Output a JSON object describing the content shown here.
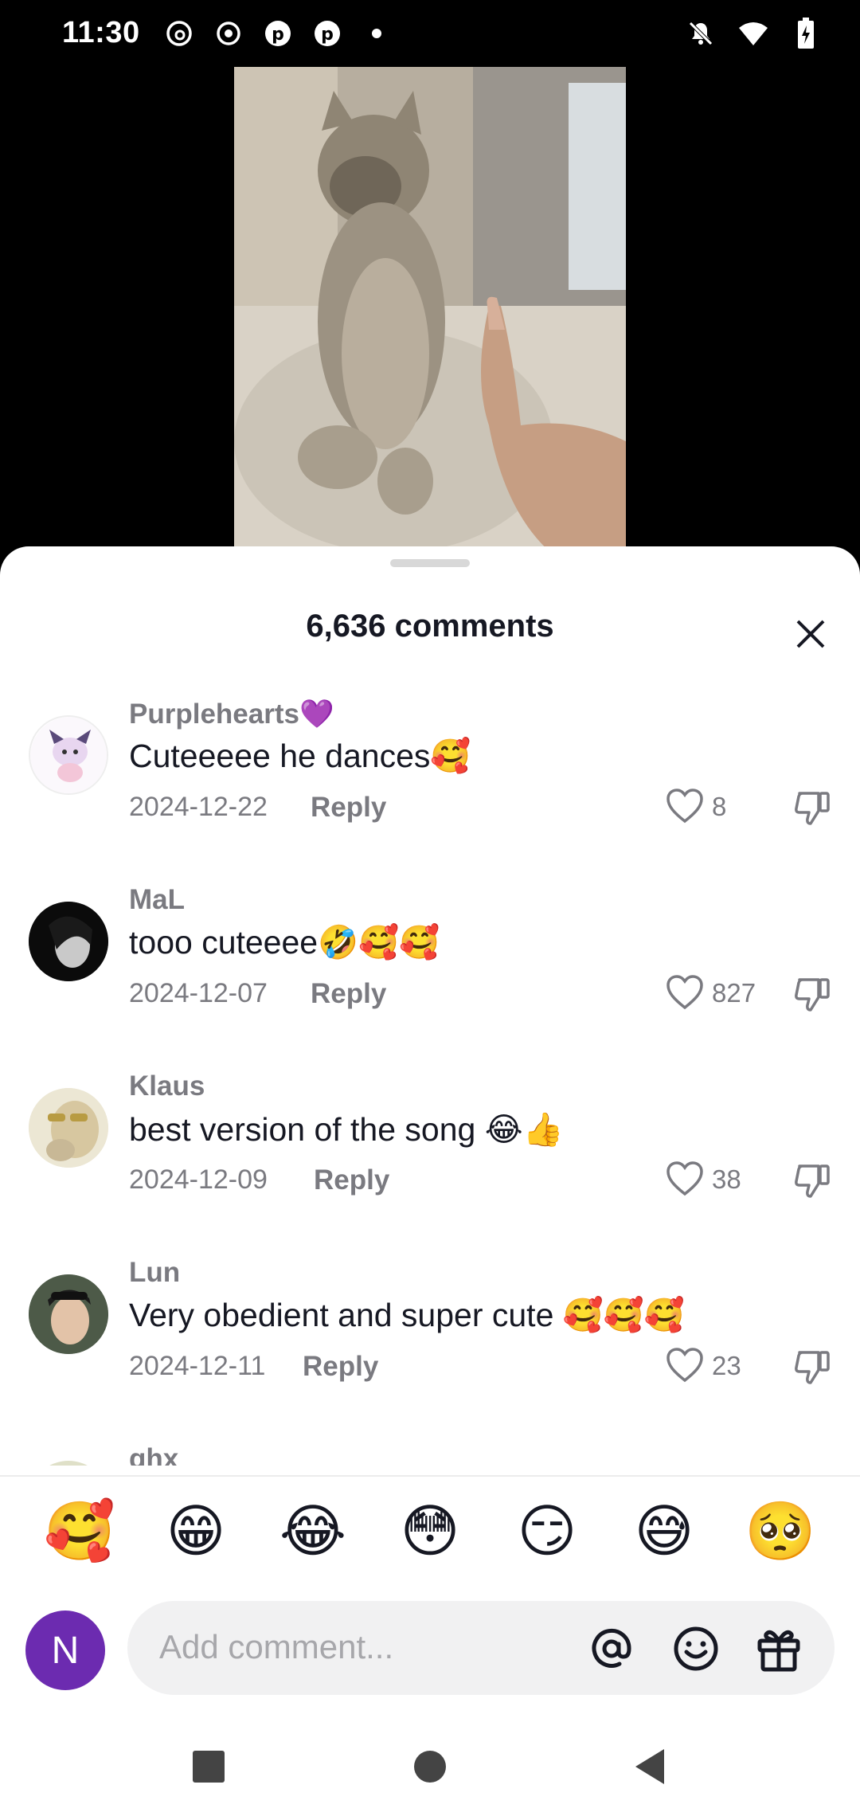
{
  "status_bar": {
    "time": "11:30",
    "left_icons": [
      "threads-icon",
      "record-icon",
      "pinterest-icon",
      "pinterest-icon",
      "dot-icon"
    ],
    "right_icons": [
      "bell-off-icon",
      "wifi-icon",
      "battery-charging-icon"
    ]
  },
  "video": {
    "subject_icon": "cat-video-thumbnail"
  },
  "sheet": {
    "title": "6,636 comments",
    "close_icon": "close-icon"
  },
  "comments": [
    {
      "username": "Purplehearts💜",
      "text": "Cuteeeee he dances🥰",
      "date": "2024-12-22",
      "reply": "Reply",
      "likes": "8"
    },
    {
      "username": "MaL",
      "text": "tooo cuteeee🤣🥰🥰",
      "date": "2024-12-07",
      "reply": "Reply",
      "likes": "827"
    },
    {
      "username": "Klaus",
      "text": "best version of the song 😂👍",
      "date": "2024-12-09",
      "reply": "Reply",
      "likes": "38"
    },
    {
      "username": "Lun",
      "text": "Very obedient and super cute 🥰🥰🥰",
      "date": "2024-12-11",
      "reply": "Reply",
      "likes": "23"
    },
    {
      "username": "ghx",
      "text": "",
      "date": "",
      "reply": "",
      "likes": ""
    }
  ],
  "emoji_bar": [
    "🥰",
    "😁",
    "😂",
    "😳",
    "😏",
    "😅",
    "🥺"
  ],
  "composer": {
    "user_initial": "N",
    "placeholder": "Add comment...",
    "icons": [
      "mention-icon",
      "emoji-icon",
      "gift-icon"
    ]
  },
  "nav": {
    "buttons": [
      "recents-button",
      "home-button",
      "back-button"
    ]
  },
  "colors": {
    "user_avatar": "#6c2bb0",
    "muted_text": "#7a7a80",
    "input_bg": "#f1f1f2"
  }
}
